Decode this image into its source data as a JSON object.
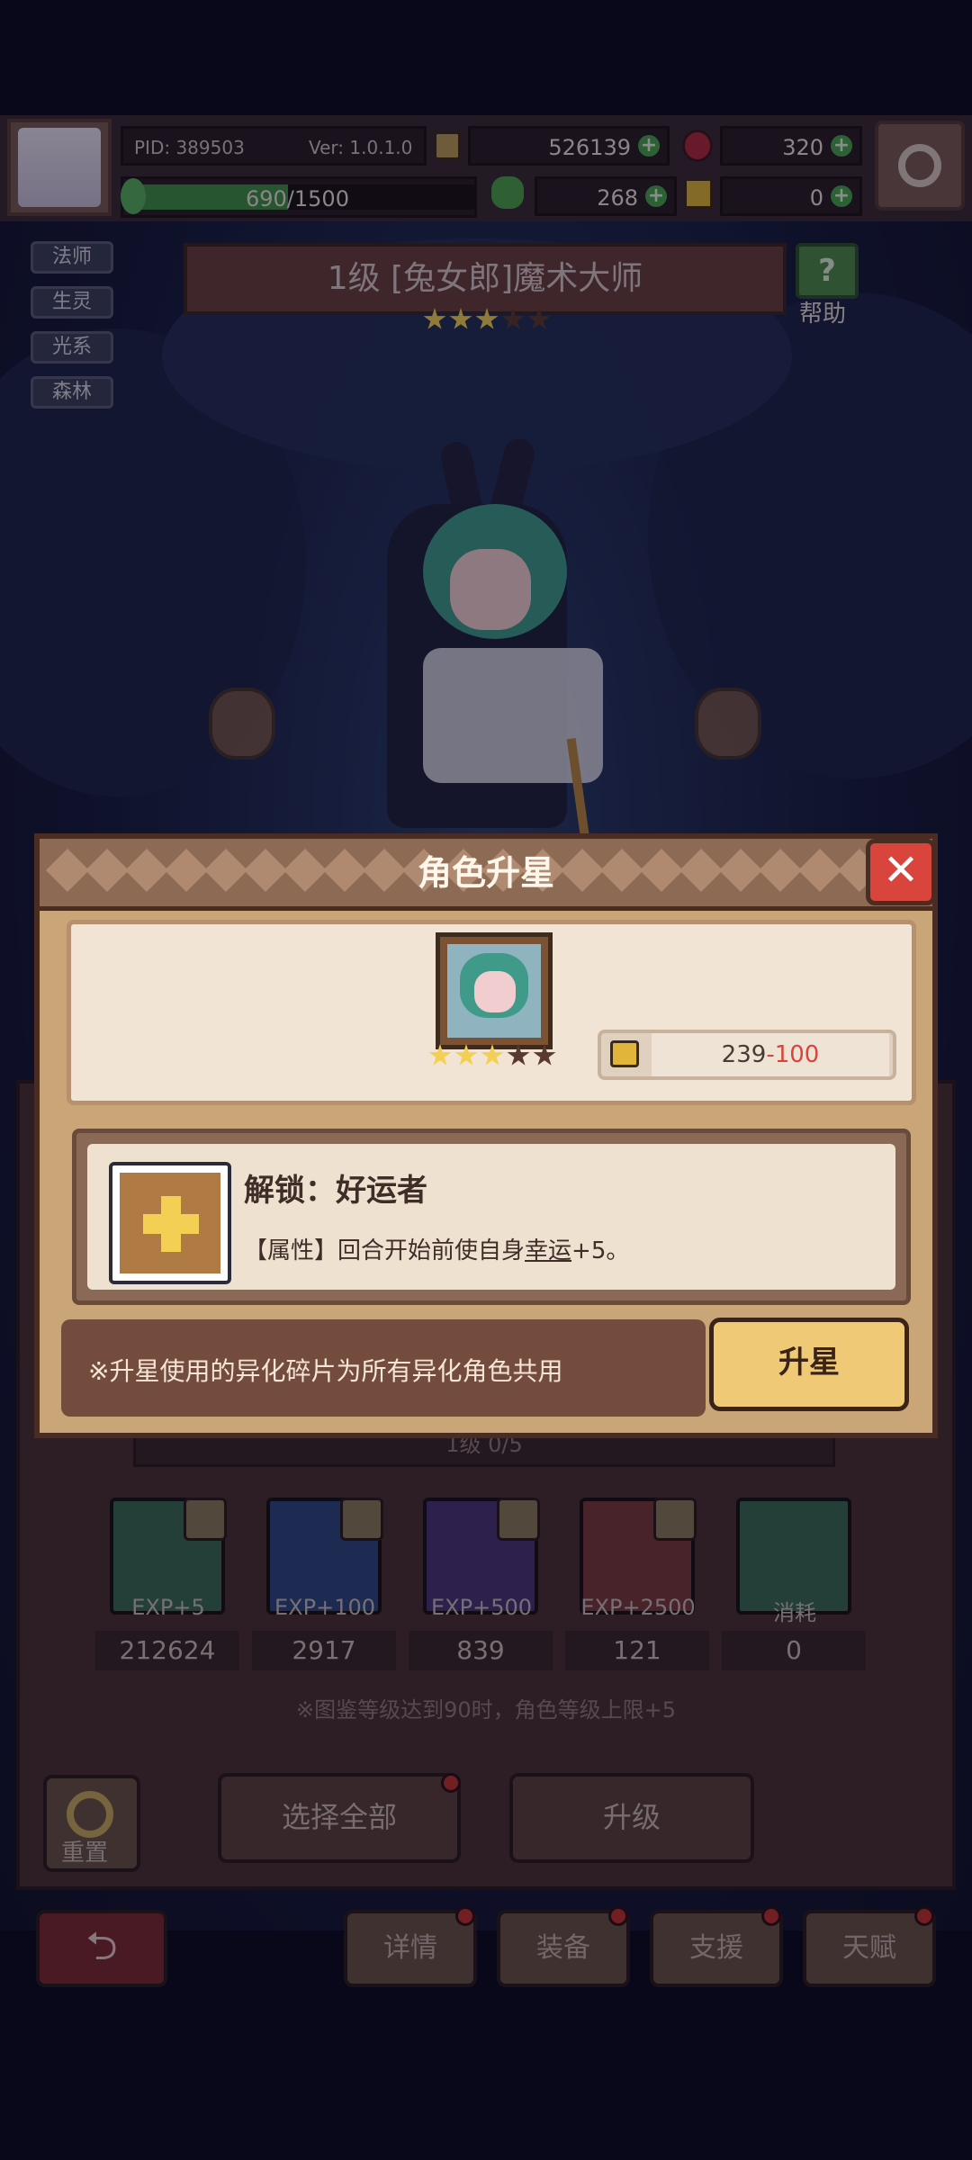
{
  "header": {
    "pid": "PID: 389503",
    "version": "Ver: 1.0.1.0",
    "gold": "526139",
    "gems": "320",
    "exp_progress": "690/1500",
    "exp_fraction": 0.46,
    "clover": "268",
    "keys": "0"
  },
  "tags": [
    "法师",
    "生灵",
    "光系",
    "森林"
  ],
  "character": {
    "title": "1级 [兔女郎]魔术大师",
    "stars_filled": 3,
    "stars_total": 5
  },
  "help": {
    "label": "帮助"
  },
  "modal": {
    "title": "角色升星",
    "shards_owned": "239",
    "shards_cost": "-100",
    "portrait_stars_filled": 3,
    "portrait_stars_total": 5,
    "unlock_title": "解锁：好运者",
    "unlock_desc_prefix": "【属性】回合开始前使自身",
    "unlock_desc_keyword": "幸运",
    "unlock_desc_suffix": "+5。",
    "note": "※升星使用的异化碎片为所有异化角色共用",
    "upgrade_star_button": "升星"
  },
  "lower": {
    "level_text": "1级 0/5",
    "items": [
      {
        "label": "EXP+5",
        "count": "212624",
        "color": "#3b6a52"
      },
      {
        "label": "EXP+100",
        "count": "2917",
        "color": "#30467e"
      },
      {
        "label": "EXP+500",
        "count": "839",
        "color": "#4a3577"
      },
      {
        "label": "EXP+2500",
        "count": "121",
        "color": "#7a3a3c"
      },
      {
        "label": "消耗",
        "count": "0",
        "color": "#3b6a52"
      }
    ],
    "hint": "※图鉴等级达到90时，角色等级上限+5",
    "reset": "重置",
    "select_all": "选择全部",
    "upgrade": "升级"
  },
  "tabs": [
    "详情",
    "装备",
    "支援",
    "天赋"
  ],
  "colors": {
    "accent_gold": "#f0c977",
    "danger_red": "#d9443c",
    "cost_red": "#d9443c",
    "star_gold": "#f3cf53"
  }
}
